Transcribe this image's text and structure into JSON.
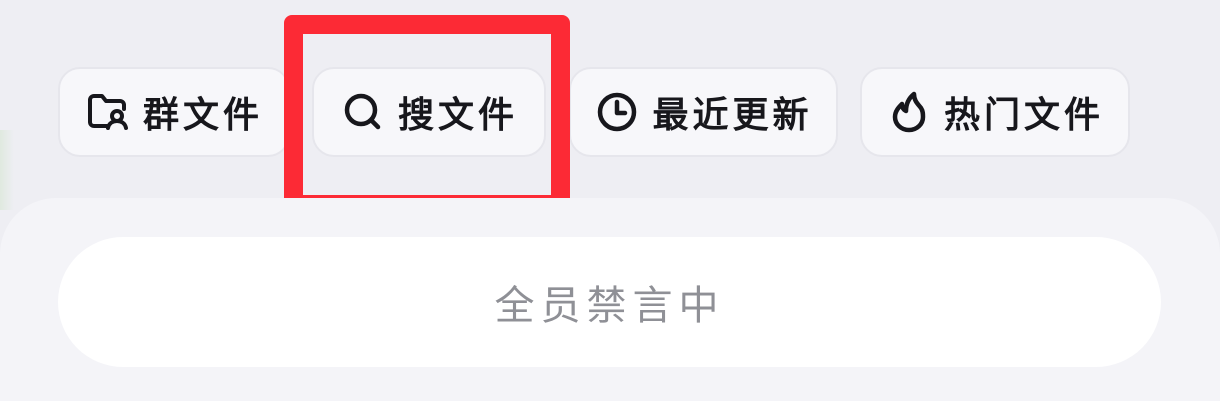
{
  "toolbar": {
    "chips": [
      {
        "label": "群文件",
        "icon": "folder-user-icon"
      },
      {
        "label": "搜文件",
        "icon": "search-icon"
      },
      {
        "label": "最近更新",
        "icon": "clock-icon"
      },
      {
        "label": "热门文件",
        "icon": "flame-icon"
      }
    ],
    "highlighted_chip": "搜文件"
  },
  "input_area": {
    "status_text": "全员禁言中"
  },
  "colors": {
    "highlight": "#fc2a35",
    "chip_background": "#f7f7fa",
    "page_background": "#eeeef3",
    "status_text": "#8f9096"
  }
}
